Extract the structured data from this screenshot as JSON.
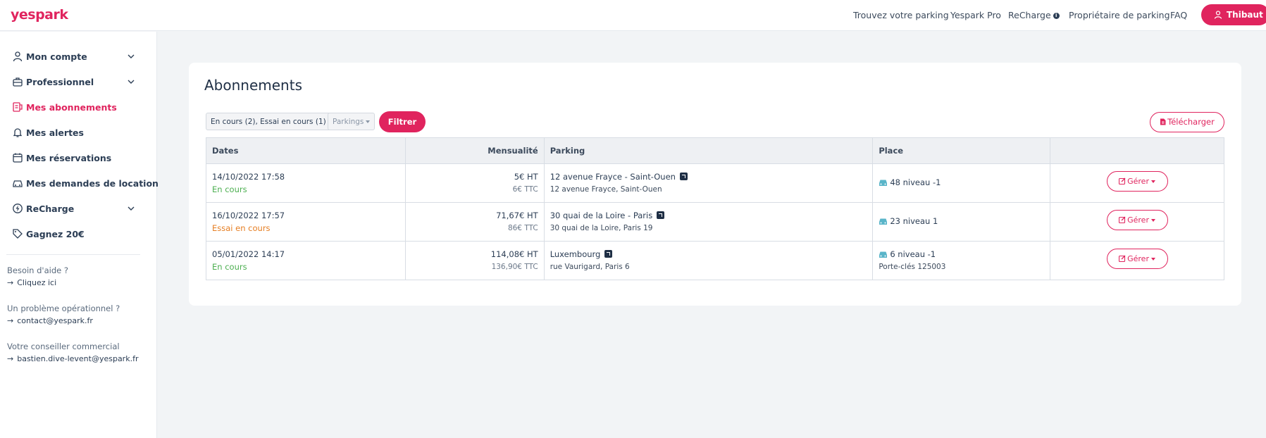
{
  "brand": {
    "logo": "yespark",
    "accent": "#e0245e"
  },
  "nav": {
    "items": [
      "Trouvez votre parking",
      "Yespark Pro",
      "ReCharge",
      "Propriétaire de parking",
      "FAQ"
    ],
    "user": "Thibaut"
  },
  "sidebar": {
    "items": [
      {
        "label": "Mon compte",
        "icon": "user-icon",
        "expandable": true
      },
      {
        "label": "Professionnel",
        "icon": "briefcase-icon",
        "expandable": true
      },
      {
        "label": "Mes abonnements",
        "icon": "subscriptions-icon",
        "active": true
      },
      {
        "label": "Mes alertes",
        "icon": "bell-icon"
      },
      {
        "label": "Mes réservations",
        "icon": "calendar-icon"
      },
      {
        "label": "Mes demandes de location",
        "icon": "car-icon"
      },
      {
        "label": "ReCharge",
        "icon": "bolt-icon",
        "expandable": true
      },
      {
        "label": "Gagnez 20€",
        "icon": "tag-icon"
      }
    ],
    "help": [
      {
        "title": "Besoin d'aide ?",
        "link": "Cliquez ici"
      },
      {
        "title": "Un problème opérationnel ?",
        "link": "contact@yespark.fr"
      },
      {
        "title": "Votre conseiller commercial",
        "link": "bastien.dive-levent@yespark.fr"
      }
    ]
  },
  "main": {
    "title": "Abonnements",
    "filters": {
      "status": "En cours (2), Essai en cours (1)",
      "parkings": "Parkings",
      "filter_button": "Filtrer",
      "download_button": "Télécharger"
    },
    "table": {
      "headers": [
        "Dates",
        "Mensualité",
        "Parking",
        "Place",
        ""
      ],
      "rows": [
        {
          "date": "14/10/2022 17:58",
          "status": "En cours",
          "price_ht": "5€ HT",
          "price_ttc": "6€ TTC",
          "parking": "12 avenue Frayce - Saint-Ouen",
          "address": "12 avenue Frayce, Saint-Ouen",
          "place": "48 niveau -1",
          "place_extra": "",
          "action": "Gérer"
        },
        {
          "date": "16/10/2022 17:57",
          "status": "Essai en cours",
          "price_ht": "71,67€ HT",
          "price_ttc": "86€ TTC",
          "parking": "30 quai de la Loire - Paris",
          "address": "30 quai de la Loire, Paris 19",
          "place": "23 niveau 1",
          "place_extra": "",
          "action": "Gérer"
        },
        {
          "date": "05/01/2022 14:17",
          "status": "En cours",
          "price_ht": "114,08€ HT",
          "price_ttc": "136,90€ TTC",
          "parking": "Luxembourg",
          "address": "rue Vaurigard, Paris 6",
          "place": "6 niveau -1",
          "place_extra": "Porte-clés 125003",
          "action": "Gérer"
        }
      ]
    }
  }
}
